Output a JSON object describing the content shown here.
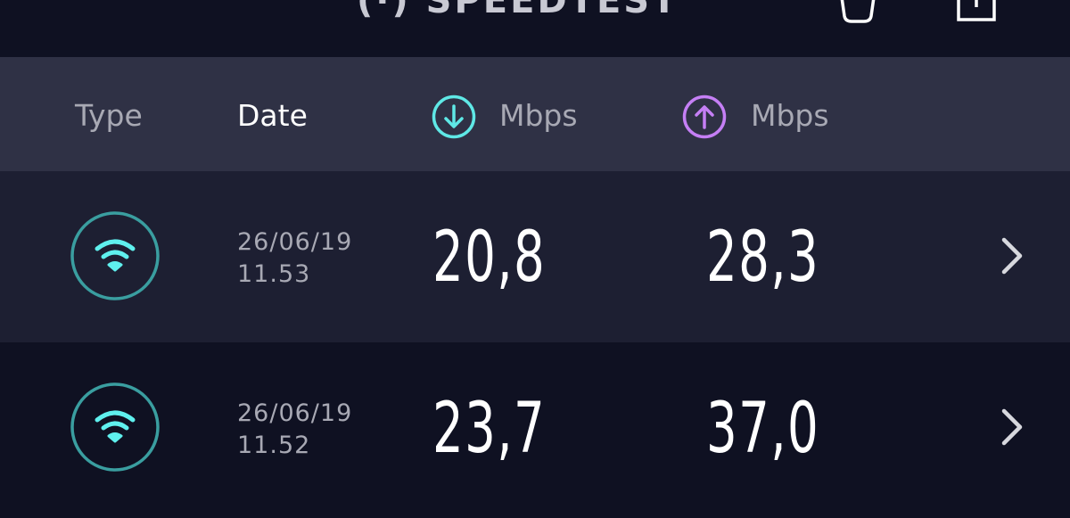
{
  "app": {
    "title": "(·) SPEEDTEST"
  },
  "toolbar": {
    "history_icon": "cup-icon",
    "share_icon": "share-icon"
  },
  "header": {
    "type_label": "Type",
    "date_label": "Date",
    "download_unit": "Mbps",
    "upload_unit": "Mbps",
    "download_icon": "download-arrow-icon",
    "upload_icon": "upload-arrow-icon"
  },
  "colors": {
    "download_accent": "#5fe8e6",
    "upload_accent": "#c57ff5",
    "wifi_ring": "#3a9ea0",
    "wifi_glyph": "#5ff0ee"
  },
  "results": [
    {
      "type_icon": "wifi-icon",
      "date": "26/06/19",
      "time": "11.53",
      "download": "20,8",
      "upload": "28,3"
    },
    {
      "type_icon": "wifi-icon",
      "date": "26/06/19",
      "time": "11.52",
      "download": "23,7",
      "upload": "37,0"
    }
  ]
}
